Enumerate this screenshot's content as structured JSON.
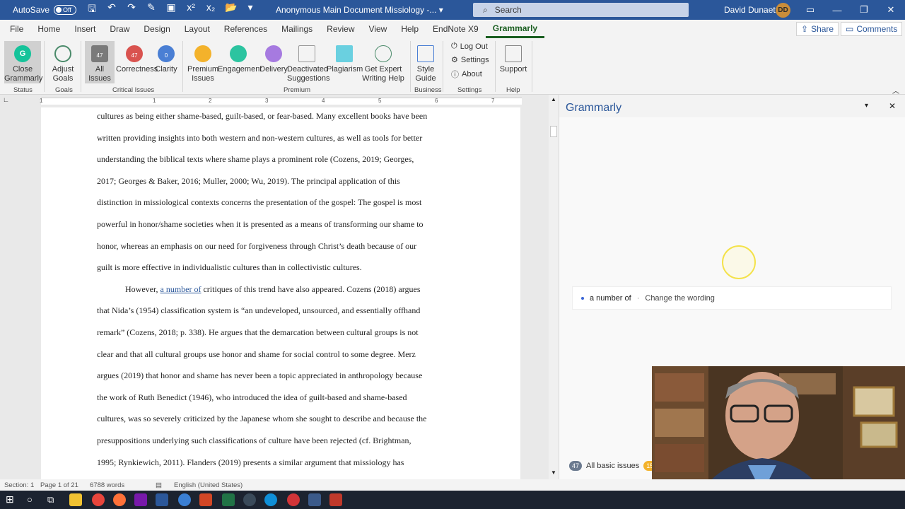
{
  "titlebar": {
    "autosave_label": "AutoSave",
    "autosave_state": "Off",
    "doc_title": "Anonymous Main Document Missiology  -...",
    "search_placeholder": "Search",
    "user_name": "David Dunaetz",
    "user_initials": "DD"
  },
  "menu": {
    "tabs": [
      "File",
      "Home",
      "Insert",
      "Draw",
      "Design",
      "Layout",
      "References",
      "Mailings",
      "Review",
      "View",
      "Help",
      "EndNote X9",
      "Grammarly"
    ],
    "active": "Grammarly",
    "share_label": "Share",
    "comments_label": "Comments"
  },
  "ribbon": {
    "close_grammarly": "Close\nGrammarly",
    "adjust_goals": "Adjust\nGoals",
    "all_issues": "All Issues",
    "all_issues_count": "47",
    "correctness": "Correctness",
    "correctness_count": "47",
    "clarity": "Clarity",
    "clarity_count": "0",
    "premium_issues": "Premium\nIssues",
    "engagement": "Engagement",
    "delivery": "Delivery",
    "deactivated": "Deactivated\nSuggestions",
    "plagiarism": "Plagiarism",
    "expert_help": "Get Expert\nWriting Help",
    "style_guide": "Style\nGuide",
    "log_out": "Log Out",
    "settings": "Settings",
    "about": "About",
    "support": "Support",
    "groups": {
      "status": "Status",
      "goals": "Goals",
      "critical": "Critical Issues",
      "premium": "Premium",
      "business": "Business",
      "settings": "Settings",
      "help": "Help"
    }
  },
  "ruler": {
    "numbers": [
      "1",
      "1",
      "2",
      "3",
      "4",
      "5",
      "6",
      "7"
    ]
  },
  "document": {
    "lines": [
      "cultures as being either shame-based, guilt-based, or fear-based. Many excellent books have been",
      "written providing insights into both western and non-western cultures, as well as tools for better",
      "understanding the biblical texts where shame plays a prominent role (Cozens, 2019; Georges,",
      "2017; Georges & Baker, 2016; Muller, 2000; Wu, 2019). The principal application of this",
      "distinction in missiological contexts concerns the presentation of the gospel: The gospel is most",
      "powerful in honor/shame societies when it is presented as a means of transforming our shame to",
      "honor, whereas an emphasis on our need for forgiveness through Christ’s death because of our",
      "guilt is more effective in individualistic cultures than in collectivistic cultures."
    ],
    "p2_pre": "However, ",
    "p2_flag": "a number of",
    "p2_post": " critiques of this trend have also appeared.  Cozens (2018) argues",
    "lines2": [
      "that Nida’s (1954) classification system is “an undeveloped, unsourced, and essentially offhand",
      "remark” (Cozens, 2018; p. 338). He argues that the demarcation between cultural groups is not",
      "clear and that all cultural groups use honor and shame for social control to some degree. Merz",
      "argues (2019) that honor and shame has never been a topic appreciated in anthropology because",
      "the work of Ruth Benedict (1946), who introduced the idea of guilt-based and shame-based",
      "cultures, was so severely criticized by the Japanese whom she sought to describe and because the",
      "presuppositions underlying such classifications of culture have been rejected (cf. Brightman,",
      "1995; Rynkiewich, 2011). Flanders (2019) presents a similar argument that missiology has"
    ]
  },
  "grammarly_pane": {
    "title": "Grammarly",
    "suggestion_phrase": "a number of",
    "suggestion_sep": "·",
    "suggestion_action": "Change the wording",
    "footer_count": "47",
    "footer_label": "All basic issues",
    "footer_premium": "15"
  },
  "statusbar": {
    "section": "Section: 1",
    "page": "Page 1 of 21",
    "words": "6788 words",
    "language": "English (United States)"
  },
  "colors": {
    "titlebar": "#2b579a",
    "grammarly_green": "#15c39a",
    "active_tab": "#1a5e20"
  }
}
